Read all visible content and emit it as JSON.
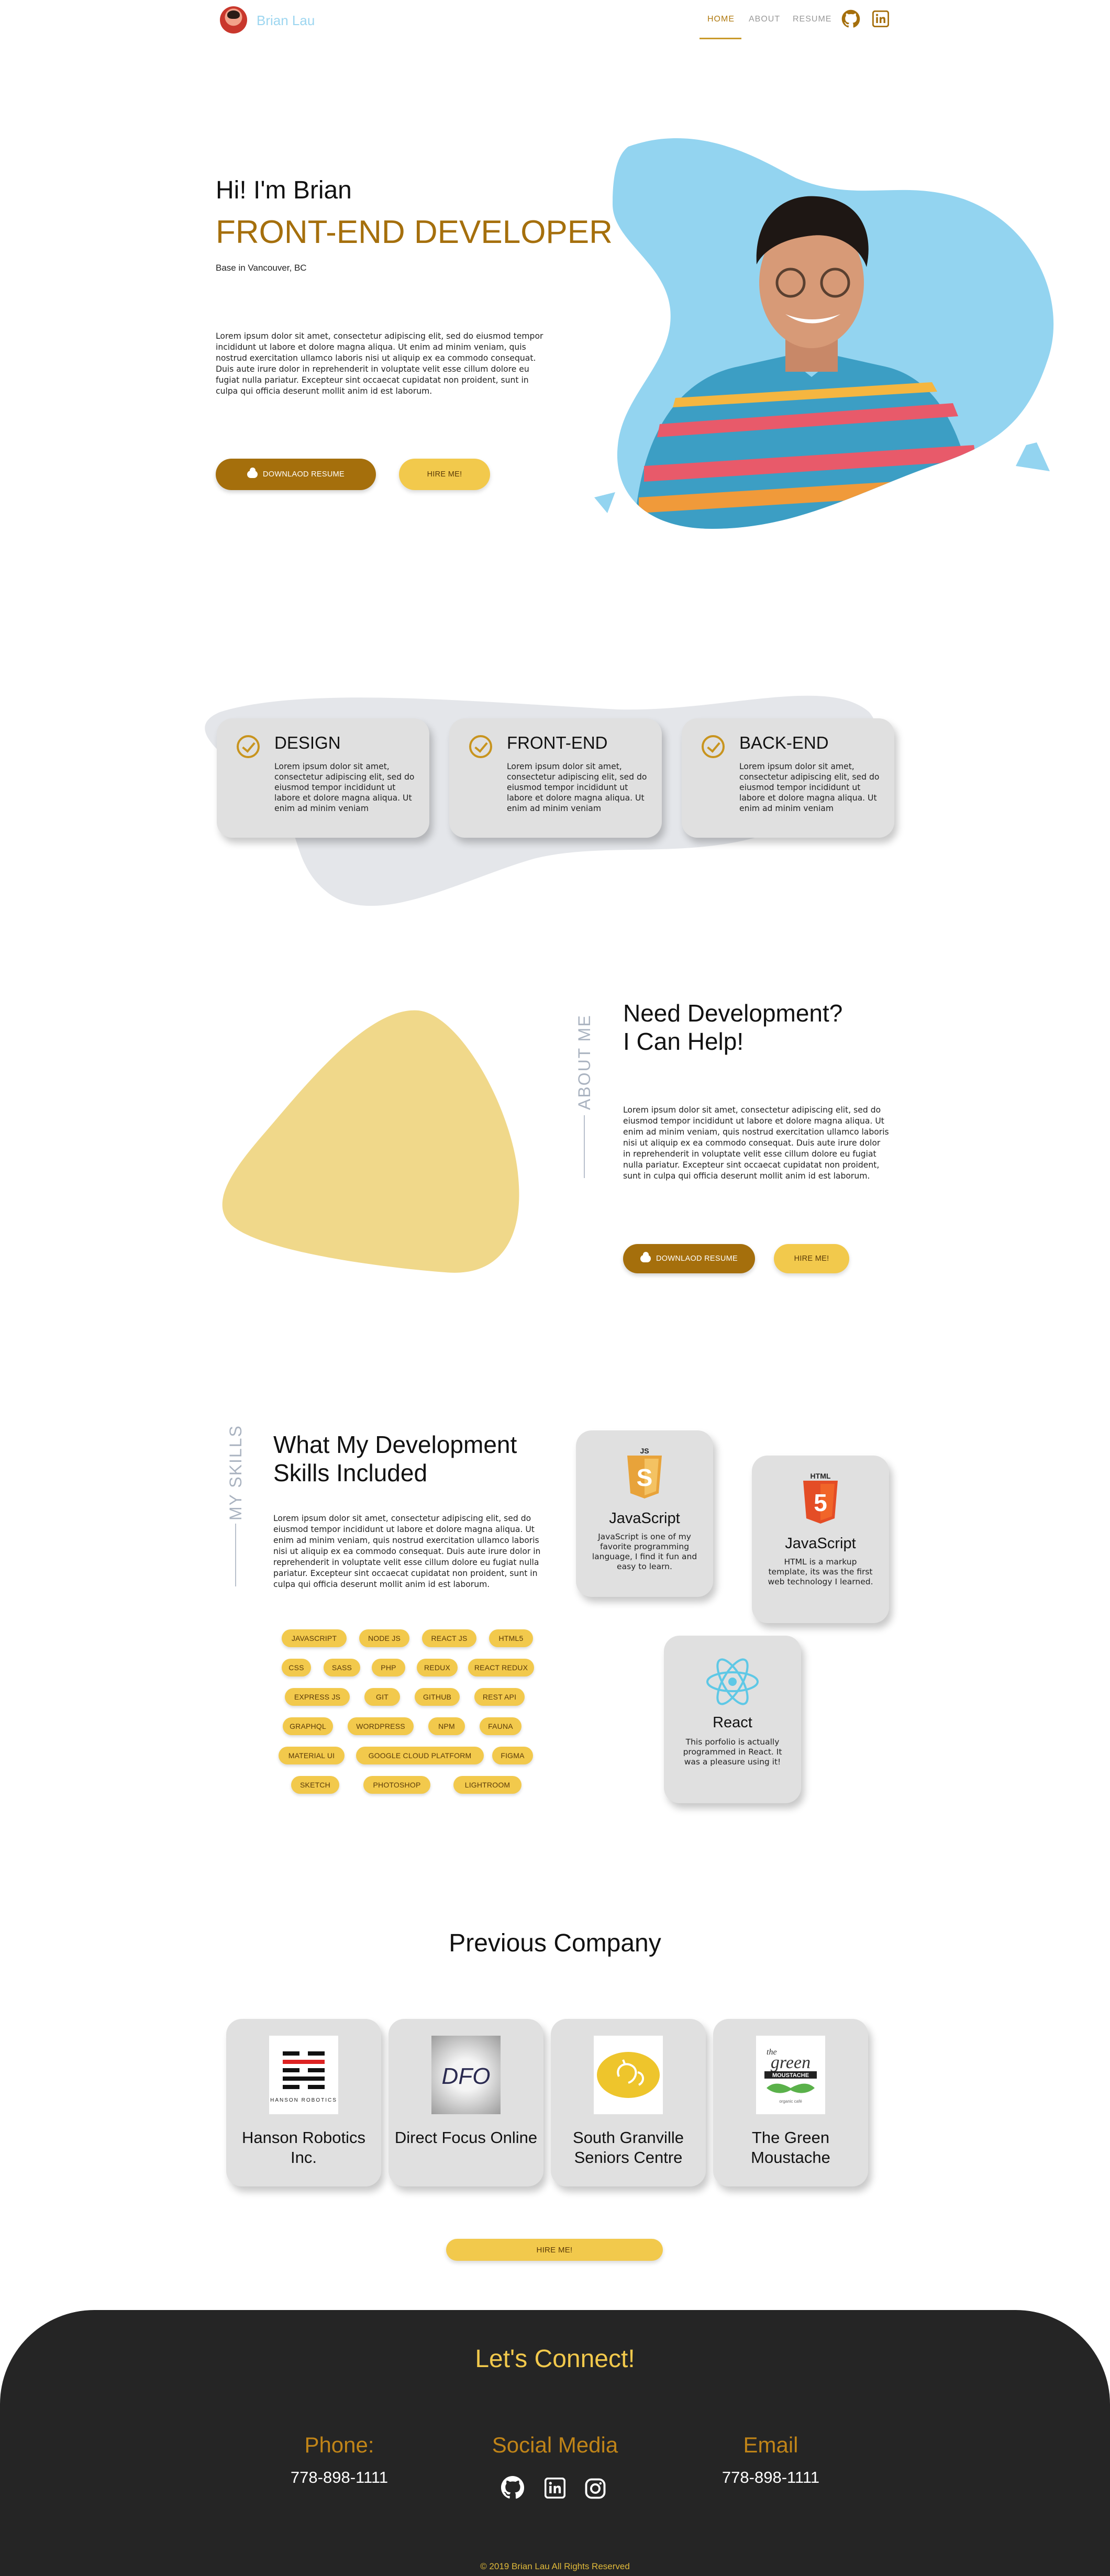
{
  "nav": {
    "brand": "Brian Lau",
    "links": [
      "HOME",
      "ABOUT",
      "RESUME"
    ],
    "icons": [
      "github-icon",
      "linkedin-icon"
    ]
  },
  "hero": {
    "greeting": "Hi! I'm Brian",
    "role": "FRONT-END DEVELOPER",
    "location": "Base in Vancouver, BC",
    "description": "Lorem ipsum dolor sit amet, consectetur adipiscing elit, sed do eiusmod tempor incididunt ut labore et dolore magna aliqua. Ut enim ad minim veniam, quis nostrud exercitation ullamco laboris nisi ut aliquip ex ea commodo consequat. Duis aute irure dolor in reprehenderit in voluptate velit esse cillum dolore eu fugiat nulla pariatur. Excepteur sint occaecat cupidatat non proident, sunt in culpa qui officia deserunt mollit anim id est laborum.",
    "download_label": "DOWNLAOD RESUME",
    "hire_label": "HIRE ME!"
  },
  "services": [
    {
      "title": "DESIGN",
      "text": "Lorem ipsum dolor sit amet, consectetur adipiscing elit, sed do eiusmod tempor incididunt ut labore et dolore magna aliqua. Ut enim ad minim veniam"
    },
    {
      "title": "FRONT-END",
      "text": "Lorem ipsum dolor sit amet, consectetur adipiscing elit, sed do eiusmod tempor incididunt ut labore et dolore magna aliqua. Ut enim ad minim veniam"
    },
    {
      "title": "BACK-END",
      "text": "Lorem ipsum dolor sit amet, consectetur adipiscing elit, sed do eiusmod tempor incididunt ut labore et dolore magna aliqua. Ut enim ad minim veniam"
    }
  ],
  "about": {
    "side_label": "ABOUT ME",
    "heading_line1": "Need Development?",
    "heading_line2": "I Can Help!",
    "description": "Lorem ipsum dolor sit amet, consectetur adipiscing elit, sed do eiusmod tempor incididunt ut labore et dolore magna aliqua. Ut enim ad minim veniam, quis nostrud exercitation ullamco laboris nisi ut aliquip ex ea commodo consequat. Duis aute irure dolor in reprehenderit in voluptate velit esse cillum dolore eu fugiat nulla pariatur. Excepteur sint occaecat cupidatat non proident, sunt in culpa qui officia deserunt mollit anim id est laborum.",
    "download_label": "DOWNLAOD RESUME",
    "hire_label": "HIRE ME!"
  },
  "skills": {
    "side_label": "MY SKILLS",
    "heading_line1": "What My Development",
    "heading_line2": "Skills Included",
    "description": "Lorem ipsum dolor sit amet, consectetur adipiscing elit, sed do eiusmod tempor incididunt ut labore et dolore magna aliqua. Ut enim ad minim veniam, quis nostrud exercitation ullamco laboris nisi ut aliquip ex ea commodo consequat. Duis aute irure dolor in reprehenderit in voluptate velit esse cillum dolore eu fugiat nulla pariatur. Excepteur sint occaecat cupidatat non proident, sunt in culpa qui officia deserunt mollit anim id est laborum.",
    "tags": [
      "JAVASCRIPT",
      "NODE JS",
      "REACT JS",
      "HTML5",
      "CSS",
      "SASS",
      "PHP",
      "REDUX",
      "REACT REDUX",
      "EXPRESS JS",
      "GIT",
      "GITHUB",
      "REST API",
      "GRAPHQL",
      "WORDPRESS",
      "NPM",
      "FAUNA",
      "MATERIAL UI",
      "GOOGLE CLOUD PLATFORM",
      "FIGMA",
      "SKETCH",
      "PHOTOSHOP",
      "LIGHTROOM"
    ],
    "cards": [
      {
        "badge": "JS",
        "name": "JavaScript",
        "desc": "JavaScript is one of my favorite programming language, I find it fun and easy to learn."
      },
      {
        "badge": "HTML",
        "name": "JavaScript",
        "desc": "HTML is a markup template, its was the first web technology I learned."
      },
      {
        "badge": "",
        "name": "React",
        "desc": "This porfolio is actually programmed in React. It was a pleasure using it!"
      }
    ]
  },
  "companies": {
    "heading": "Previous Company",
    "items": [
      {
        "name": "Hanson Robotics Inc.",
        "logo_text": "HANSON ROBOTICS"
      },
      {
        "name": "Direct Focus Online",
        "logo_text": "DFO"
      },
      {
        "name": "South Granville Seniors Centre",
        "logo_text": ""
      },
      {
        "name": "The Green Moustache",
        "logo_text": "the green MOUSTACHE organic café"
      }
    ],
    "hire_label": "HIRE ME!"
  },
  "footer": {
    "title": "Let's Connect!",
    "phone_title": "Phone:",
    "phone": "778-898-1111",
    "social_title": "Social Media",
    "social_icons": [
      "github-icon",
      "linkedin-icon",
      "instagram-icon"
    ],
    "email_title": "Email",
    "email": "778-898-1111",
    "copyright": "© 2019 Brian Lau All Rights Reserved"
  },
  "colors": {
    "accent_dark": "#a56f0c",
    "accent_light": "#f2c94c",
    "sky_blob": "#93d4f0",
    "footer_bg": "#252525"
  }
}
